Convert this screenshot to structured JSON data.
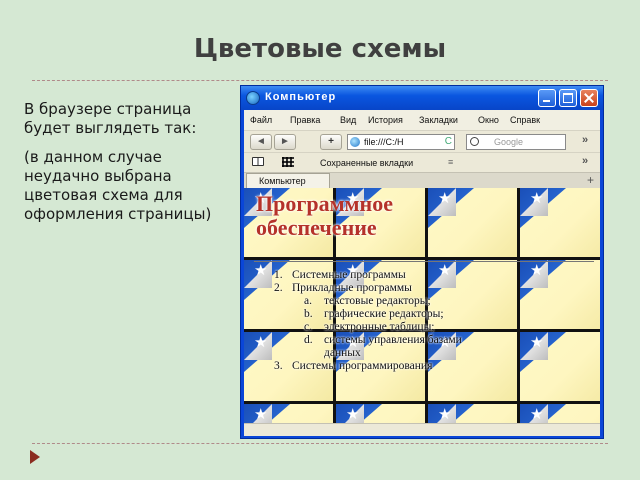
{
  "slide": {
    "title": "Цветовые схемы",
    "paragraph1": "В браузере страница будет выглядеть так:",
    "paragraph2": "(в данном случае неудачно выбрана цветовая схема для оформления страницы)"
  },
  "browser": {
    "window_title": "Компьютер",
    "menu": [
      "Файл",
      "Правка",
      "Вид",
      "История",
      "Закладки",
      "Окно",
      "Справка"
    ],
    "nav": {
      "back": "◄",
      "forward": "►",
      "add": "+",
      "url": "file:///C:/H",
      "reload": "C",
      "search_placeholder": "Google",
      "overflow": "»"
    },
    "bookmarks_label": "Сохраненные вкладки",
    "tab_label": "Компьютер",
    "new_tab": "+"
  },
  "page": {
    "heading_line1": "Программное",
    "heading_line2": "обеспечение",
    "list": [
      {
        "num": "1.",
        "text": "Системные программы"
      },
      {
        "num": "2.",
        "text": "Прикладные программы"
      },
      {
        "num": "a.",
        "text": "текстовые редакторы;",
        "level": 2
      },
      {
        "num": "b.",
        "text": "графические редакторы;",
        "level": 2
      },
      {
        "num": "c.",
        "text": "электронные таблицы;",
        "level": 2
      },
      {
        "num": "d.",
        "text": "системы управления базами",
        "level": 2
      },
      {
        "num": "",
        "text": "данных",
        "level": 3
      },
      {
        "num": "3.",
        "text": "Системы программирования"
      }
    ]
  },
  "colors": {
    "slide_bg": "#d5e8d3",
    "window_frame": "#0a46d8",
    "page_bg": "#fff6b8",
    "heading": "#b5322a"
  }
}
